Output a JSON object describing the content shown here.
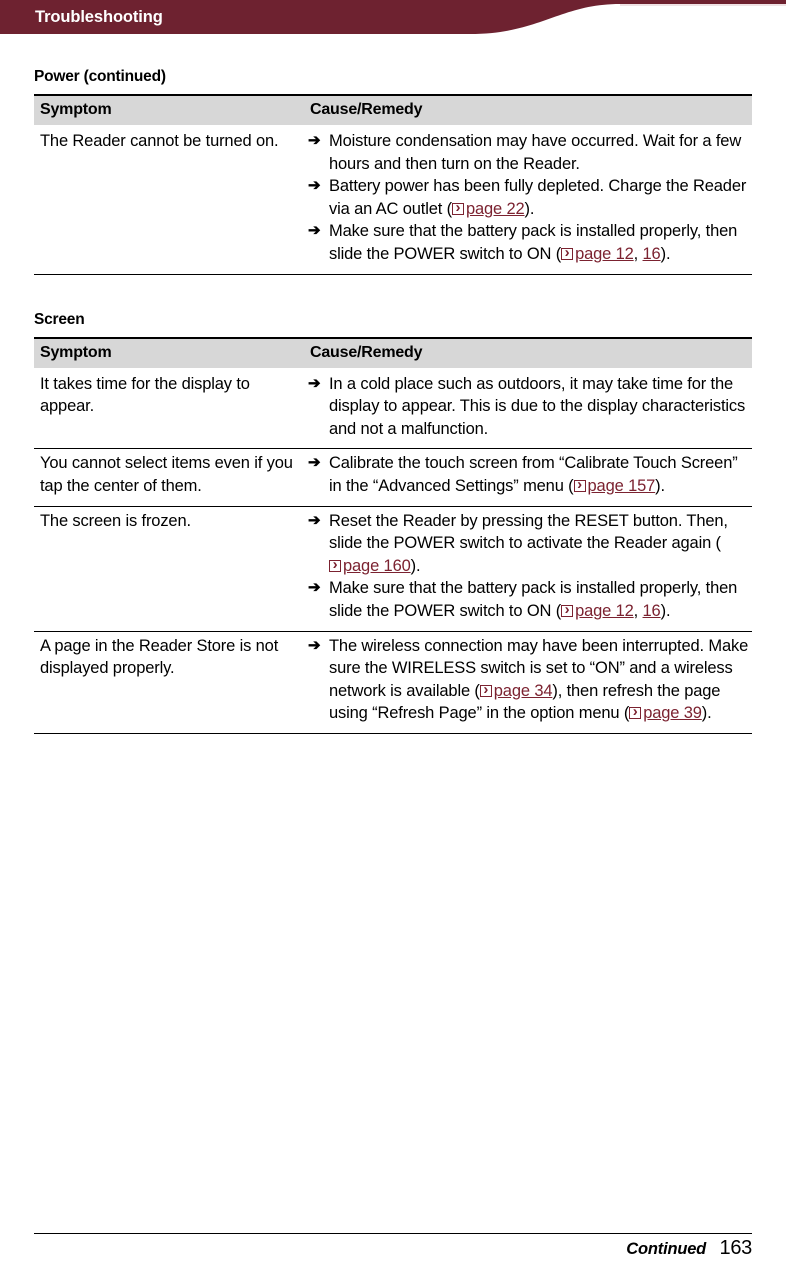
{
  "header": {
    "title": "Troubleshooting",
    "band_color": "#6e2230",
    "hairline_color": "#efe2e4"
  },
  "sections": [
    {
      "heading": "Power (continued)",
      "columns": {
        "symptom": "Symptom",
        "remedy": "Cause/Remedy"
      },
      "rows": [
        {
          "symptom": "The Reader cannot be turned on.",
          "remedies": [
            {
              "parts": [
                {
                  "type": "text",
                  "text": "Moisture condensation may have occurred. Wait for a few hours and then turn on the Reader."
                }
              ]
            },
            {
              "parts": [
                {
                  "type": "text",
                  "text": "Battery power has been fully depleted. Charge the Reader via an AC outlet ("
                },
                {
                  "type": "link",
                  "text": "page 22"
                },
                {
                  "type": "text",
                  "text": ")."
                }
              ]
            },
            {
              "parts": [
                {
                  "type": "text",
                  "text": "Make sure that the battery pack is installed properly, then slide the POWER switch to ON ("
                },
                {
                  "type": "link",
                  "text": "page 12"
                },
                {
                  "type": "text",
                  "text": ", "
                },
                {
                  "type": "link-plain",
                  "text": "16"
                },
                {
                  "type": "text",
                  "text": ")."
                }
              ]
            }
          ]
        }
      ]
    },
    {
      "heading": "Screen",
      "columns": {
        "symptom": "Symptom",
        "remedy": "Cause/Remedy"
      },
      "rows": [
        {
          "symptom": "It takes time for the display to appear.",
          "remedies": [
            {
              "parts": [
                {
                  "type": "text",
                  "text": "In a cold place such as outdoors, it may take time for the display to appear. This is due to the display characteristics and not a malfunction."
                }
              ]
            }
          ]
        },
        {
          "symptom": "You cannot select items even if you tap the center of them.",
          "remedies": [
            {
              "parts": [
                {
                  "type": "text",
                  "text": "Calibrate the touch screen from “Calibrate Touch Screen” in the “Advanced Settings” menu ("
                },
                {
                  "type": "link",
                  "text": "page 157"
                },
                {
                  "type": "text",
                  "text": ")."
                }
              ]
            }
          ]
        },
        {
          "symptom": "The screen is frozen.",
          "remedies": [
            {
              "parts": [
                {
                  "type": "text",
                  "text": "Reset the Reader by pressing the RESET button. Then, slide the POWER switch to activate the Reader again ("
                },
                {
                  "type": "link",
                  "text": "page 160"
                },
                {
                  "type": "text",
                  "text": ")."
                }
              ]
            },
            {
              "parts": [
                {
                  "type": "text",
                  "text": "Make sure that the battery pack is installed properly, then slide the POWER switch to ON ("
                },
                {
                  "type": "link",
                  "text": "page 12"
                },
                {
                  "type": "text",
                  "text": ", "
                },
                {
                  "type": "link-plain",
                  "text": "16"
                },
                {
                  "type": "text",
                  "text": ")."
                }
              ]
            }
          ]
        },
        {
          "symptom": "A page in the Reader Store is not displayed properly.",
          "remedies": [
            {
              "parts": [
                {
                  "type": "text",
                  "text": "The wireless connection may have been interrupted. Make sure the WIRELESS switch is set to “ON” and a wireless network is available ("
                },
                {
                  "type": "link",
                  "text": "page 34"
                },
                {
                  "type": "text",
                  "text": "), then refresh the page using “Refresh Page” in the option menu ("
                },
                {
                  "type": "link",
                  "text": "page 39"
                },
                {
                  "type": "text",
                  "text": ")."
                }
              ]
            }
          ]
        }
      ]
    }
  ],
  "footer": {
    "continued": "Continued",
    "page_number": "163"
  },
  "icons": {
    "bullet_arrow": "arrow-right-glyph",
    "page_link": "page-reference-icon"
  }
}
